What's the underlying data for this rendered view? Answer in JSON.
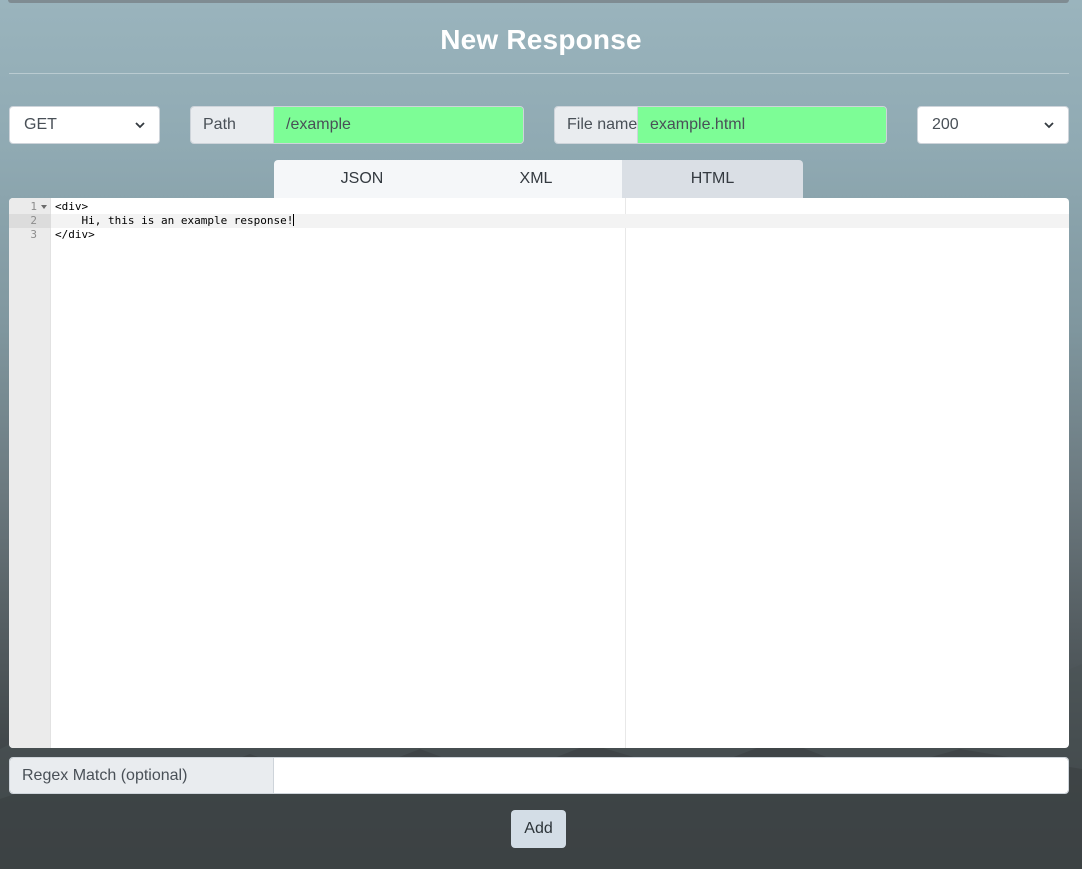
{
  "header": {
    "title": "New Response"
  },
  "method_select": {
    "value": "GET"
  },
  "path_group": {
    "label": "Path",
    "value": "/example"
  },
  "filename_group": {
    "label": "File name",
    "value": "example.html"
  },
  "status_select": {
    "value": "200"
  },
  "tabs": [
    {
      "label": "JSON",
      "active": false
    },
    {
      "label": "XML",
      "active": false
    },
    {
      "label": "HTML",
      "active": true
    }
  ],
  "editor": {
    "line_numbers": [
      "1",
      "2",
      "3"
    ],
    "lines": [
      "<div>",
      "    Hi, this is an example response!",
      "</div>"
    ],
    "active_line": 2,
    "fold_icon": "fold-arrow-icon"
  },
  "regex": {
    "label": "Regex Match (optional)",
    "value": ""
  },
  "add_button": {
    "label": "Add"
  },
  "colors": {
    "valid_input": "#7dfd96",
    "addon": "#e9ecef",
    "active_tab": "#dadfe5",
    "add_button": "#d3dde6"
  }
}
